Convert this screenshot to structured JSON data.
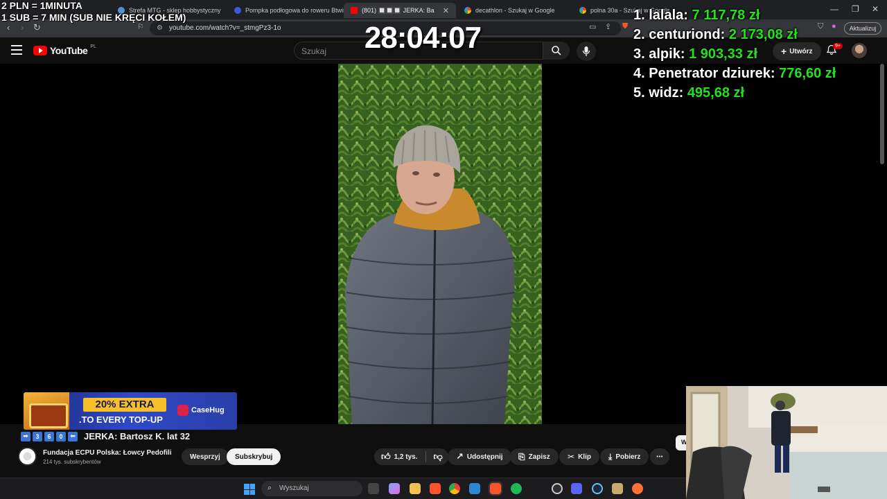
{
  "overlay": {
    "rule_line1": "2 PLN = 1MINUTA",
    "rule_line2": "1 SUB = 7 MIN (SUB NIE KRĘCI KOŁEM)",
    "timer": "28:04:07",
    "leaderboard": [
      {
        "rank": "1.",
        "name": "lalala:",
        "amount": "7 117,78 zł"
      },
      {
        "rank": "2.",
        "name": "centuriond:",
        "amount": "2 173,08 zł"
      },
      {
        "rank": "3.",
        "name": "alpik:",
        "amount": "1 903,33 zł"
      },
      {
        "rank": "4.",
        "name": "Penetrator dziurek:",
        "amount": "776,60 zł"
      },
      {
        "rank": "5.",
        "name": "widz:",
        "amount": "495,68 zł"
      }
    ],
    "amount_color": "#22e21c"
  },
  "browser": {
    "tabs": [
      {
        "label": "Strefa MTG - sklep hobbystyczny",
        "favicon_color": "#5b8dd6"
      },
      {
        "label": "Pompka podłogowa do roweru Btwin",
        "favicon_color": "#3b5bdb"
      },
      {
        "label": "(801) 🔲🔲🔲 JERKA: Ba",
        "favicon_color": "#ff0000"
      },
      {
        "label": "decathlon - Szukaj w Google",
        "favicon_color": "#e8e8e8"
      },
      {
        "label": "polna 30a - Szukaj w Google",
        "favicon_color": "#e8e8e8"
      }
    ],
    "url": "youtube.com/watch?v=_stmgPz3-1o",
    "update_label": "Aktualizuj",
    "notification_badge": "1"
  },
  "youtube": {
    "logo_text": "YouTube",
    "region": "PL",
    "search_placeholder": "Szukaj",
    "create_label": "Utwórz",
    "bell_badge": "9+",
    "video_title": "JERKA: Bartosz K. lat 32",
    "title_keys": [
      "➡",
      "3",
      "6",
      "0",
      "⬅"
    ],
    "channel_name": "Fundacja ECPU Polska: Łowcy Pedofili",
    "channel_subs": "214 tys. subskrybentów",
    "support_label": "Wesprzyj",
    "subscribe_label": "Subskrybuj",
    "like_count": "1,2 tys.",
    "share_label": "Udostępnij",
    "save_label": "Zapisz",
    "clip_label": "Klip",
    "download_label": "Pobierz",
    "side_chip": "W"
  },
  "ad": {
    "line1": "20% EXTRA",
    "line2": ".TO EVERY TOP-UP",
    "brand": "CaseHug"
  },
  "taskbar": {
    "search_placeholder": "Wyszukaj",
    "apps": [
      {
        "name": "terminal-app-icon",
        "color": "#444"
      },
      {
        "name": "copilot-app-icon",
        "color": "#7aa7ff"
      },
      {
        "name": "explorer-app-icon",
        "color": "#f2c14e"
      },
      {
        "name": "brave-app-icon",
        "color": "#fb542b"
      },
      {
        "name": "chrome-app-icon",
        "color": "#4caf50"
      },
      {
        "name": "store-app-icon",
        "color": "#2b88d8"
      },
      {
        "name": "brave-active-app-icon",
        "color": "#fb542b"
      },
      {
        "name": "spotify-app-icon",
        "color": "#1db954"
      },
      {
        "name": "obs-app-icon",
        "color": "#302e31"
      },
      {
        "name": "discord-app-icon",
        "color": "#5865f2"
      },
      {
        "name": "steam-app-icon",
        "color": "#1b2838"
      },
      {
        "name": "riot-app-icon",
        "color": "#c8aa6e"
      },
      {
        "name": "firefox-app-icon",
        "color": "#ff7139"
      }
    ]
  }
}
